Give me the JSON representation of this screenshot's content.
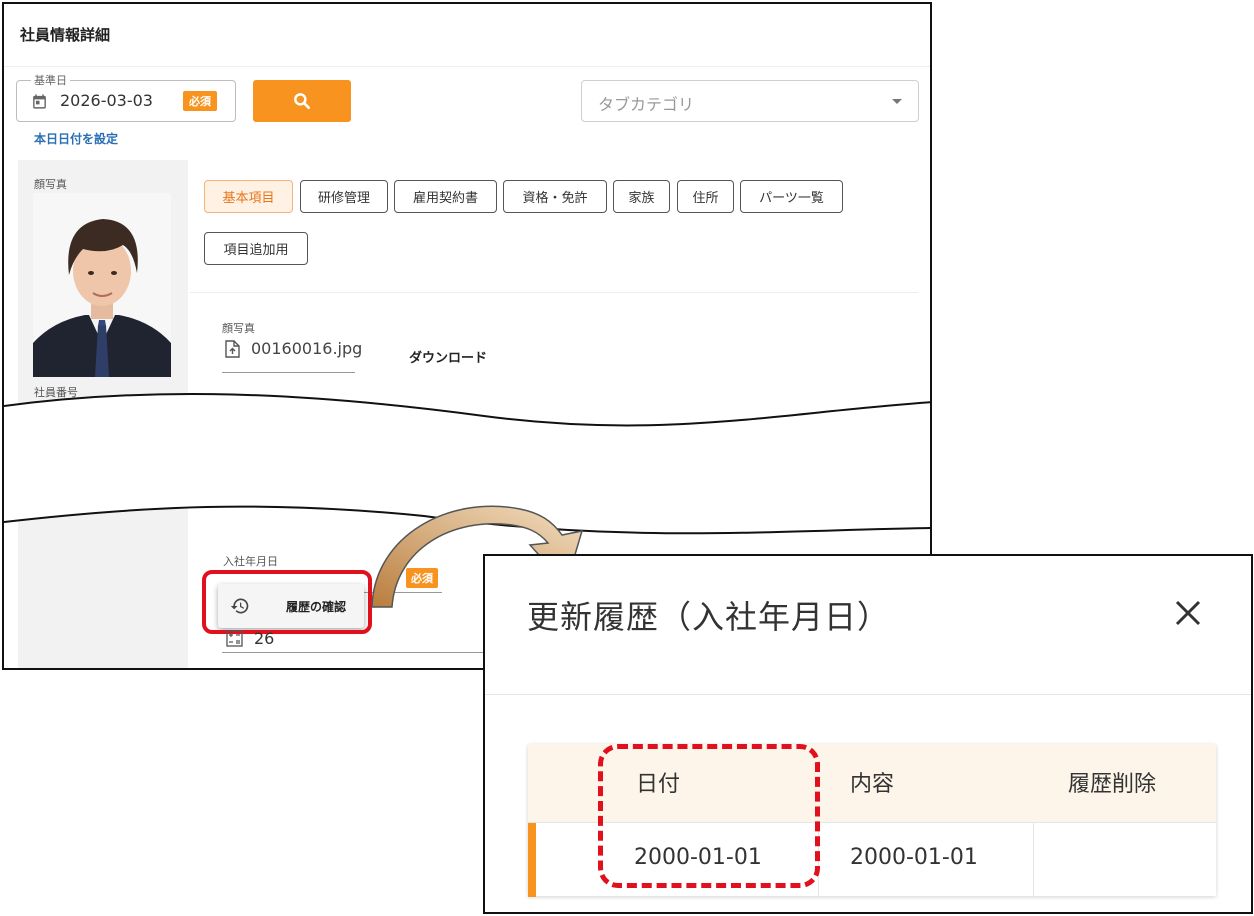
{
  "main": {
    "title": "社員情報詳細",
    "base_date": {
      "legend": "基準日",
      "value": "2026-03-03",
      "required_badge": "必須",
      "calendar_icon": "calendar-icon"
    },
    "search_icon": "search-icon",
    "set_today_link": "本日日付を設定",
    "tab_category": {
      "placeholder": "タブカテゴリ"
    },
    "left_panel": {
      "face_label": "顔写真",
      "employee_no_label": "社員番号"
    },
    "tabs": [
      "基本項目",
      "研修管理",
      "雇用契約書",
      "資格・免許",
      "家族",
      "住所",
      "パーツ一覧",
      "項目追加用"
    ],
    "active_tab": "基本項目",
    "photo_field": {
      "label": "顔写真",
      "file_name": "00160016.jpg",
      "download_label": "ダウンロード"
    },
    "hire_date_field": {
      "label": "入社年月日",
      "required_badge": "必須"
    },
    "history_menu": {
      "label": "履歴の確認",
      "icon": "history-icon"
    },
    "number_field": {
      "value": "26"
    }
  },
  "dialog": {
    "title": "更新履歴（入社年月日）",
    "close_icon": "close-icon",
    "columns": [
      "日付",
      "内容",
      "履歴削除"
    ],
    "rows": [
      {
        "date": "2000-01-01",
        "content": "2000-01-01",
        "delete": ""
      }
    ]
  },
  "colors": {
    "accent": "#f7931e",
    "highlight": "#e0101c",
    "link": "#2a6fb4",
    "arrow": "#c8924f"
  }
}
